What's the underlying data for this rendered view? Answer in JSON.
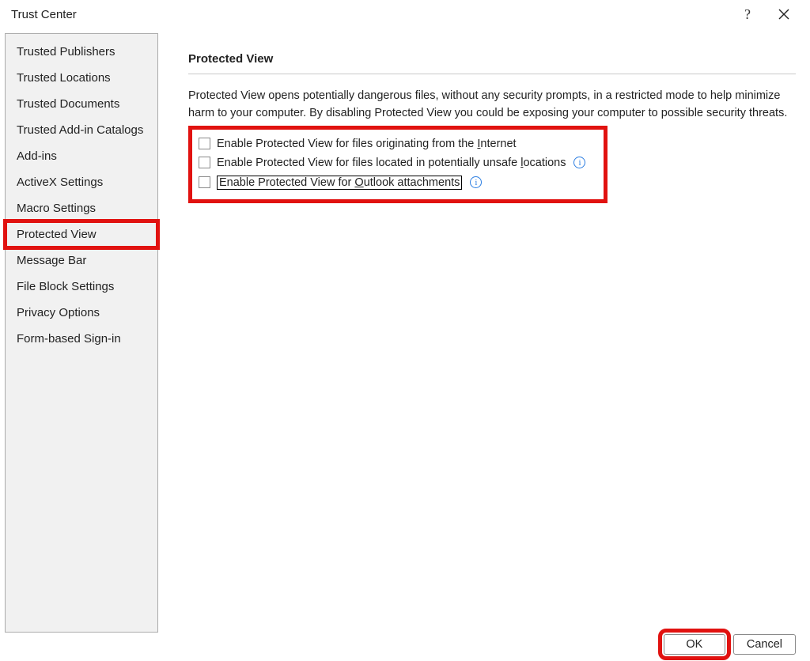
{
  "titlebar": {
    "title": "Trust Center",
    "help_glyph": "?",
    "close_label": "Close"
  },
  "sidebar": {
    "items": [
      {
        "label": "Trusted Publishers"
      },
      {
        "label": "Trusted Locations"
      },
      {
        "label": "Trusted Documents"
      },
      {
        "label": "Trusted Add-in Catalogs"
      },
      {
        "label": "Add-ins"
      },
      {
        "label": "ActiveX Settings"
      },
      {
        "label": "Macro Settings"
      },
      {
        "label": "Protected View",
        "highlighted": true
      },
      {
        "label": "Message Bar"
      },
      {
        "label": "File Block Settings"
      },
      {
        "label": "Privacy Options"
      },
      {
        "label": "Form-based Sign-in"
      }
    ]
  },
  "main": {
    "section_title": "Protected View",
    "description": "Protected View opens potentially dangerous files, without any security prompts, in a restricted mode to help minimize harm to your computer. By disabling Protected View you could be exposing your computer to possible security threats.",
    "options": [
      {
        "checked": false,
        "pre": "Enable Protected View for files originating from the ",
        "mn": "I",
        "post": "nternet",
        "info": false,
        "focused": false
      },
      {
        "checked": false,
        "pre": "Enable Protected View for files located in potentially unsafe ",
        "mn": "l",
        "post": "ocations",
        "info": true,
        "focused": false
      },
      {
        "checked": false,
        "pre": "Enable Protected View for ",
        "mn": "O",
        "post": "utlook attachments",
        "info": true,
        "focused": true
      }
    ]
  },
  "footer": {
    "ok_label": "OK",
    "cancel_label": "Cancel"
  },
  "glyphs": {
    "info": "i"
  }
}
